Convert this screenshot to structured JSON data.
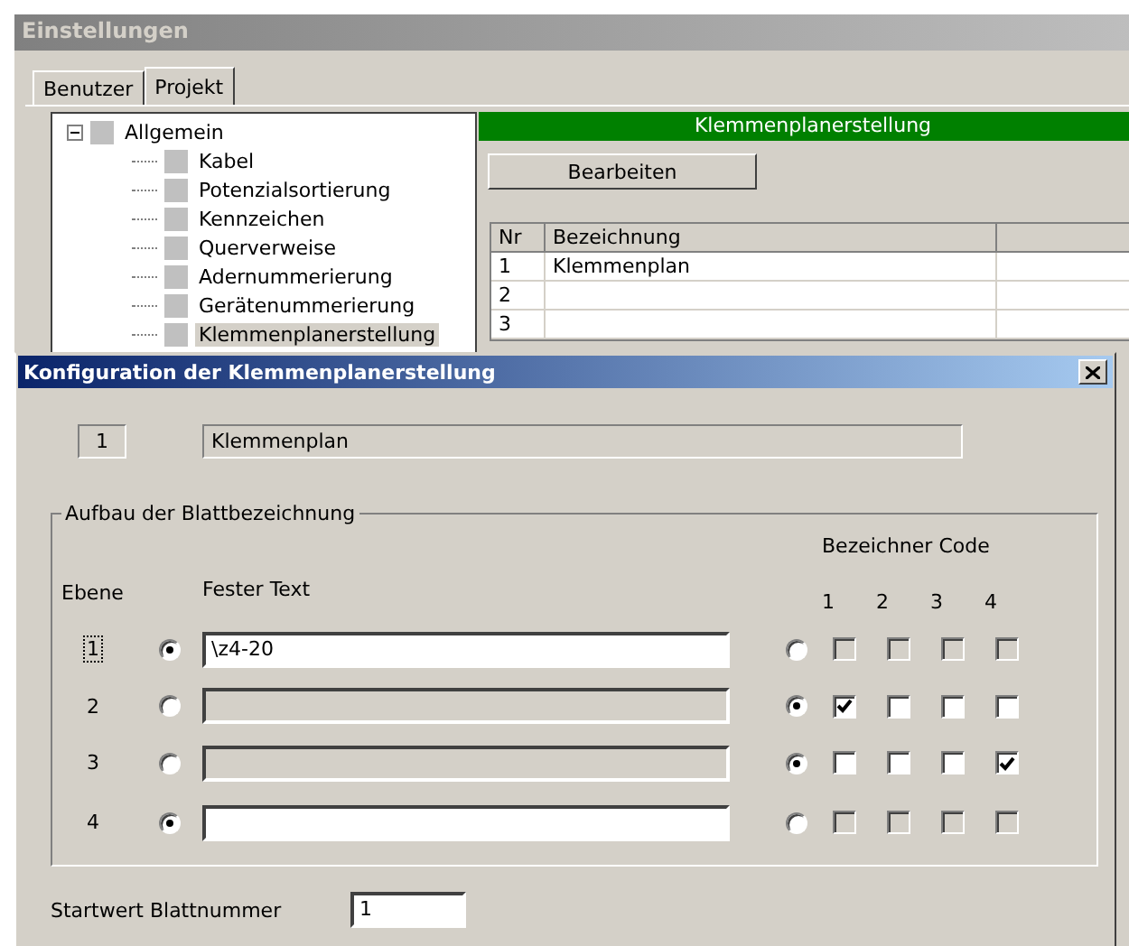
{
  "window": {
    "title": "Einstellungen"
  },
  "tabs": [
    {
      "label": "Benutzer",
      "selected": false
    },
    {
      "label": "Projekt",
      "selected": true
    }
  ],
  "tree": {
    "items": [
      {
        "label": "Allgemein",
        "expanded": true,
        "selected": false,
        "children": [
          {
            "label": "Kabel",
            "selected": false
          },
          {
            "label": "Potenzialsortierung",
            "selected": false
          },
          {
            "label": "Kennzeichen",
            "selected": false
          },
          {
            "label": "Querverweise",
            "selected": false
          },
          {
            "label": "Adernummerierung",
            "selected": false
          },
          {
            "label": "Gerätenummerierung",
            "selected": false
          },
          {
            "label": "Klemmenplanerstellung",
            "selected": true
          }
        ]
      }
    ]
  },
  "panel": {
    "header": "Klemmenplanerstellung",
    "button": "Bearbeiten",
    "table": {
      "columns": [
        "Nr",
        "Bezeichnung"
      ],
      "rows": [
        {
          "nr": "1",
          "name": "Klemmenplan"
        },
        {
          "nr": "2"
        },
        {
          "nr": "3"
        }
      ]
    }
  },
  "dialog": {
    "title": "Konfiguration der Klemmenplanerstellung",
    "number": "1",
    "name": "Klemmenplan",
    "group": {
      "legend": "Aufbau der Blattbezeichnung",
      "code_header": "Bezeichner Code",
      "level_header": "Ebene",
      "text_header": "Fester Text",
      "code_columns": [
        "1",
        "2",
        "3",
        "4"
      ],
      "rows": [
        {
          "level": "1",
          "focused": true,
          "text_selected": true,
          "code_selected": false,
          "text": "\\z4-20",
          "codes": [
            {
              "checked": false
            },
            {
              "checked": false
            },
            {
              "checked": false
            },
            {
              "checked": false
            }
          ]
        },
        {
          "level": "2",
          "focused": false,
          "text_selected": false,
          "code_selected": true,
          "codes": [
            {
              "checked": true
            },
            {
              "checked": false
            },
            {
              "checked": false
            },
            {
              "checked": false
            }
          ]
        },
        {
          "level": "3",
          "focused": false,
          "text_selected": false,
          "code_selected": true,
          "codes": [
            {
              "checked": false
            },
            {
              "checked": false
            },
            {
              "checked": false
            },
            {
              "checked": true
            }
          ]
        },
        {
          "level": "4",
          "focused": false,
          "text_selected": true,
          "code_selected": false,
          "codes": [
            {
              "checked": false
            },
            {
              "checked": false
            },
            {
              "checked": false
            },
            {
              "checked": false
            }
          ]
        }
      ]
    },
    "start_label": "Startwert Blattnummer",
    "start_value": "1"
  }
}
